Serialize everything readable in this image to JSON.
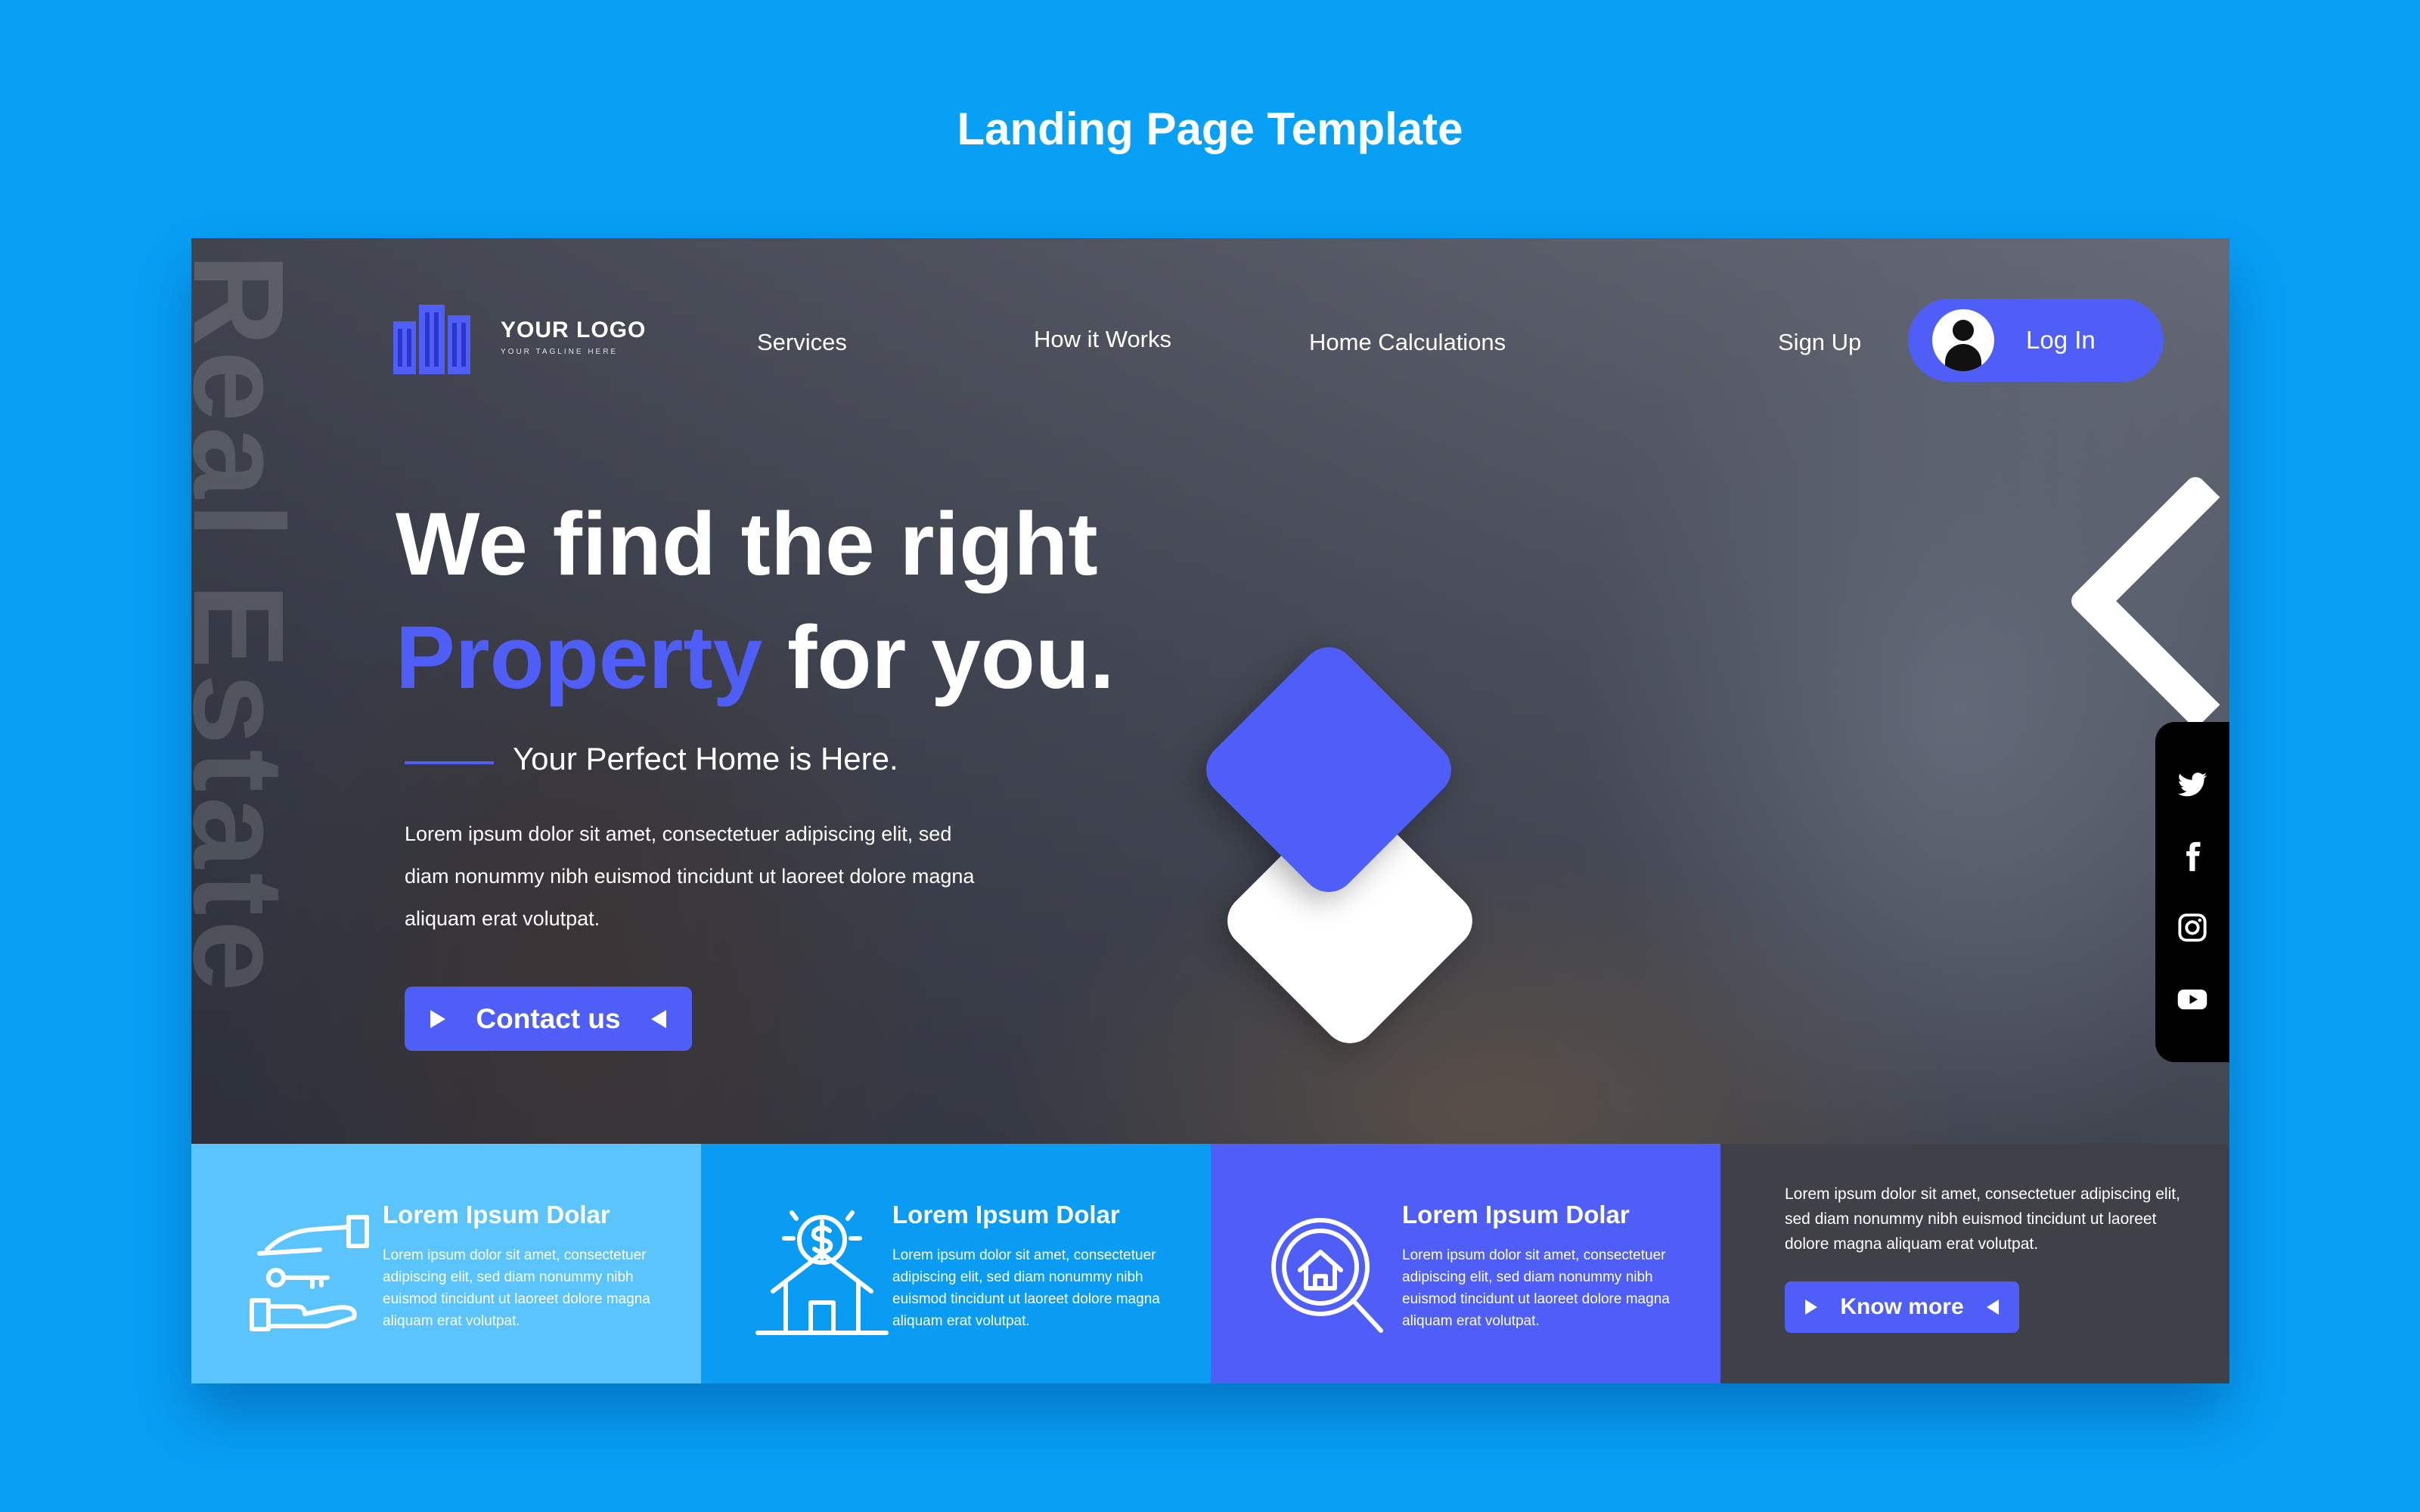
{
  "page": {
    "title": "Landing Page Template"
  },
  "hero": {
    "background_word": "Real Estate",
    "headline_line1": "We find the right",
    "headline_accent": "Property",
    "headline_rest": " for you.",
    "subtitle": "Your Perfect Home is Here.",
    "body": "Lorem ipsum dolor sit amet, consectetuer adipiscing elit, sed diam nonummy nibh euismod tincidunt ut laoreet dolore magna aliquam erat volutpat.",
    "contact_label": "Contact us"
  },
  "logo": {
    "name": "YOUR LOGO",
    "tagline": "YOUR TAGLINE HERE"
  },
  "nav": {
    "services": "Services",
    "how_it_works": "How it Works",
    "home_calculations": "Home Calculations",
    "sign_up": "Sign Up",
    "log_in": "Log In"
  },
  "social": [
    "twitter-icon",
    "facebook-icon",
    "instagram-icon",
    "youtube-icon"
  ],
  "cards": [
    {
      "title": "Lorem Ipsum Dolar",
      "text": "Lorem ipsum dolor sit amet, consectetuer adipiscing elit, sed diam nonummy nibh euismod tincidunt ut laoreet dolore magna aliquam erat volutpat.",
      "icon": "hand-key-icon"
    },
    {
      "title": "Lorem Ipsum Dolar",
      "text": "Lorem ipsum dolor sit amet, consectetuer adipiscing elit, sed diam nonummy nibh euismod tincidunt ut laoreet dolore magna aliquam erat volutpat.",
      "icon": "house-dollar-icon"
    },
    {
      "title": "Lorem Ipsum Dolar",
      "text": "Lorem ipsum dolor sit amet, consectetuer adipiscing elit, sed diam nonummy nibh euismod tincidunt ut laoreet dolore magna aliquam erat volutpat.",
      "icon": "house-search-icon"
    }
  ],
  "card4": {
    "text": "Lorem ipsum dolor sit amet, consectetuer adipiscing elit, sed diam nonummy nibh euismod tincidunt ut laoreet dolore magna aliquam erat volutpat.",
    "button_label": "Know more"
  },
  "colors": {
    "background": "#07a0f5",
    "accent": "#4f5ef7",
    "card1": "#5cc4fd",
    "card2": "#0a9cf3",
    "card3": "#4f5ef7",
    "card4": "#404048"
  }
}
